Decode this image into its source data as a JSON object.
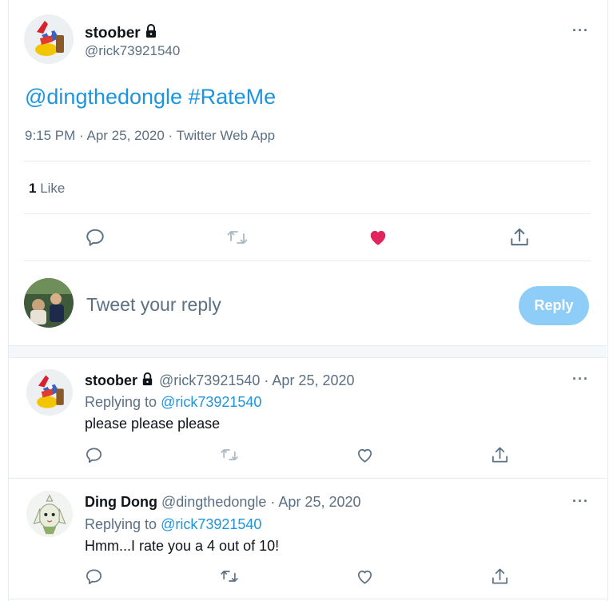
{
  "main_tweet": {
    "author_name": "stoober",
    "author_handle": "@rick73921540",
    "text_mention": "@dingthedongle",
    "text_hashtag": "#RateMe",
    "meta": "9:15 PM · Apr 25, 2020 · Twitter Web App",
    "likes_count": "1",
    "likes_label": "Like",
    "liked": true,
    "more": "···"
  },
  "compose": {
    "placeholder": "Tweet your reply",
    "reply_button": "Reply"
  },
  "replies": [
    {
      "author_name": "stoober",
      "author_handle": "@rick73921540",
      "dot": "·",
      "date": "Apr 25, 2020",
      "replying_label": "Replying to",
      "replying_to": "@rick73921540",
      "text": "please please please",
      "more": "···"
    },
    {
      "author_name": "Ding Dong",
      "author_handle": "@dingthedongle",
      "dot": "·",
      "date": "Apr 25, 2020",
      "replying_label": "Replying to",
      "replying_to": "@rick73921540",
      "text": "Hmm...I rate you a 4 out of 10!",
      "more": "···"
    }
  ],
  "colors": {
    "accent": "#1b95e0",
    "like": "#e0245e",
    "reply_button": "#8ecdf8",
    "muted": "#5b7083"
  }
}
